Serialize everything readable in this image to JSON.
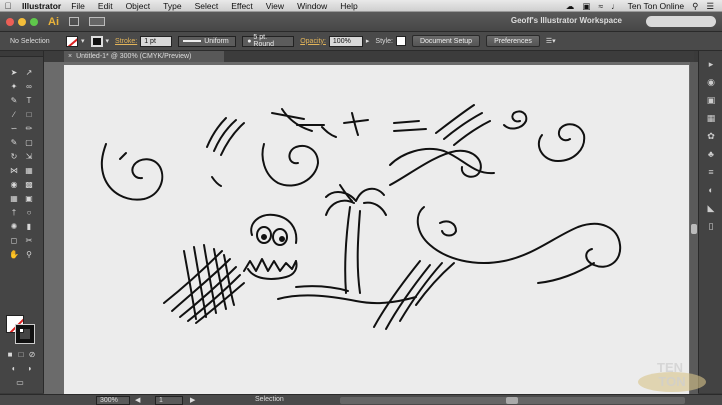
{
  "menubar": {
    "app_name": "Illustrator",
    "items": [
      "File",
      "Edit",
      "Object",
      "Type",
      "Select",
      "Effect",
      "View",
      "Window",
      "Help"
    ],
    "user": "Ten Ton Online"
  },
  "appbar": {
    "logo": "Ai",
    "workspace": "Geoff's Illustrator Workspace"
  },
  "controlbar": {
    "selection": "No Selection",
    "stroke_label": "Stroke:",
    "stroke_value": "1 pt",
    "profile": "Uniform",
    "brush": "5 pt. Round",
    "opacity_label": "Opacity:",
    "opacity_value": "100%",
    "style_label": "Style:",
    "doc_setup": "Document Setup",
    "preferences": "Preferences"
  },
  "document": {
    "tab_title": "Untitled-1* @ 300% (CMYK/Preview)"
  },
  "statusbar": {
    "zoom": "300%",
    "page": "1",
    "tool": "Selection"
  },
  "colors": {
    "menubar": "#dcdcdc",
    "panel": "#454545",
    "artboard": "#ececec",
    "accent": "#e2b45a",
    "ai_logo": "#e8b23a"
  }
}
